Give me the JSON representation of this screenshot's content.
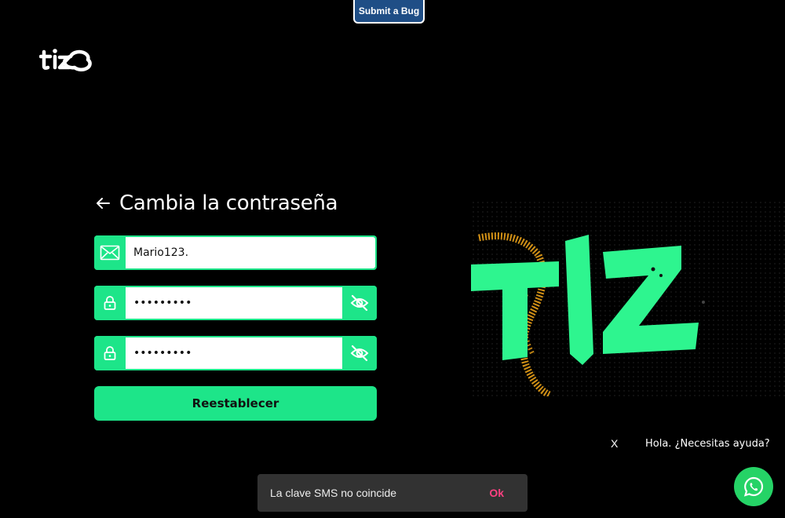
{
  "bug_button": {
    "label": "Submit a Bug"
  },
  "brand": {
    "name": "tizo",
    "accent": "#1de589",
    "background": "#000000"
  },
  "form": {
    "title": "Cambia la contraseña",
    "email_value": "Mario123.",
    "password_value": "•••••••••",
    "confirm_value": "•••••••••",
    "submit_label": "Reestablecer",
    "icons": [
      "envelope-icon",
      "lock-icon",
      "eye-slash-icon"
    ]
  },
  "hero": {
    "text": "TIZ",
    "colors": {
      "letters": "#2ef58f",
      "swirl": "#e8a018"
    }
  },
  "help": {
    "close_label": "X",
    "text": "Hola. ¿Necesitas ayuda?"
  },
  "snackbar": {
    "message": "La clave SMS no coincide",
    "action": "Ok",
    "action_color": "#ff4081"
  }
}
